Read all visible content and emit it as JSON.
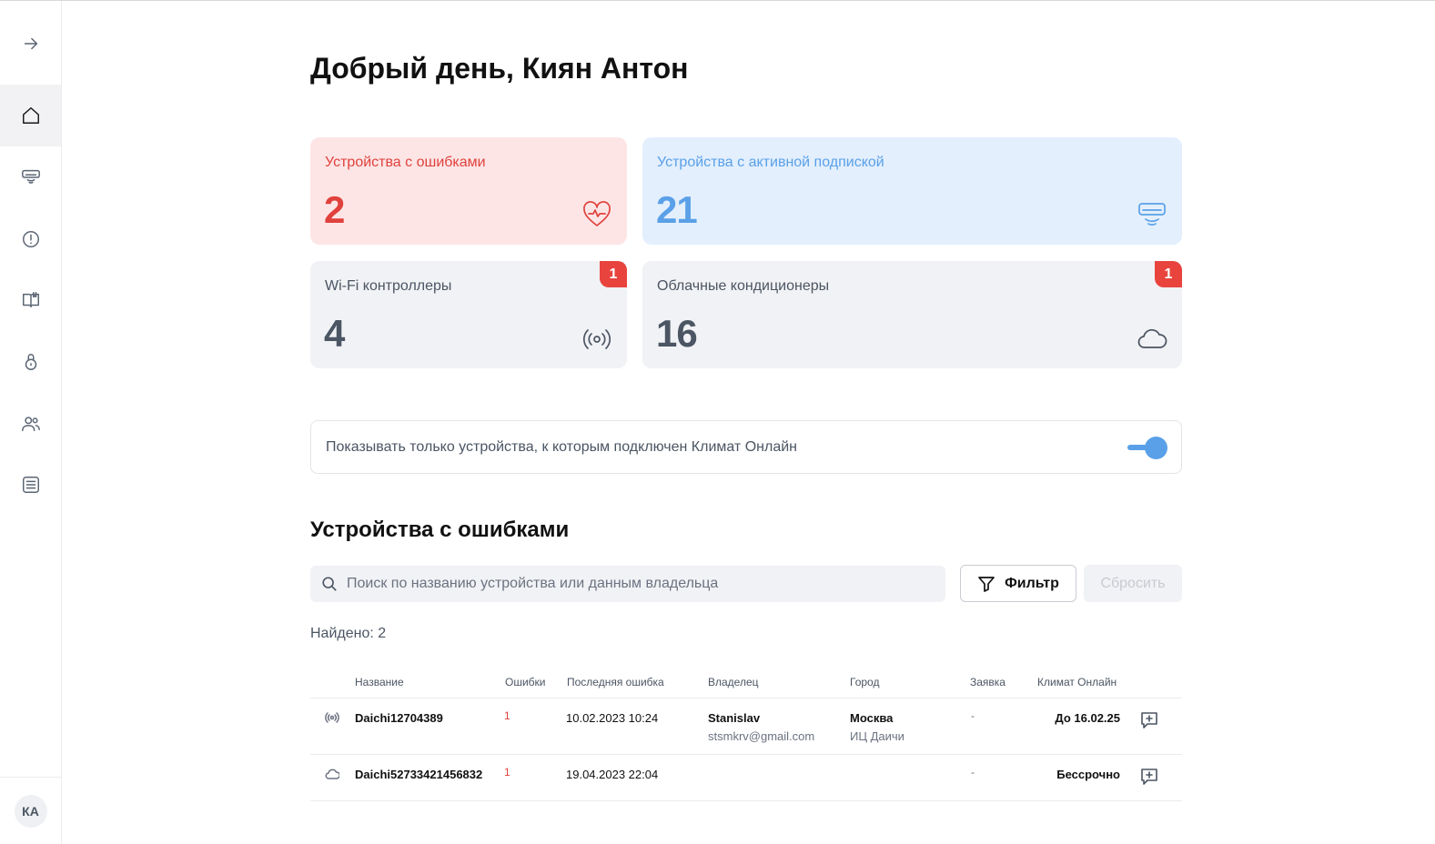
{
  "sidebar": {
    "items": [
      {
        "icon": "arrow-right-icon"
      },
      {
        "icon": "home-icon",
        "active": true
      },
      {
        "icon": "air-conditioner-icon"
      },
      {
        "icon": "alert-circle-icon"
      },
      {
        "icon": "book-icon"
      },
      {
        "icon": "lock-icon"
      },
      {
        "icon": "users-icon"
      },
      {
        "icon": "list-icon"
      }
    ],
    "avatar_initials": "КА"
  },
  "greeting": "Добрый день, Киян Антон",
  "cards": {
    "errors": {
      "title": "Устройства с ошибками",
      "value": "2",
      "icon": "heart-pulse-icon",
      "color": "#e0413c",
      "bg": "#fde5e6"
    },
    "subscription": {
      "title": "Устройства с активной подпиской",
      "value": "21",
      "icon": "air-conditioner-icon",
      "color": "#5aa0e8",
      "bg": "#e3effd"
    },
    "wifi": {
      "title": "Wi-Fi контроллеры",
      "value": "4",
      "badge": "1",
      "icon": "broadcast-icon"
    },
    "cloud": {
      "title": "Облачные кондиционеры",
      "value": "16",
      "badge": "1",
      "icon": "cloud-icon"
    }
  },
  "toggle": {
    "label": "Показывать только устройства, к которым подключен Климат Онлайн",
    "on": true
  },
  "section_title": "Устройства с ошибками",
  "search": {
    "placeholder": "Поиск по названию устройства или данным владельца",
    "value": ""
  },
  "filter_label": "Фильтр",
  "reset_label": "Сбросить",
  "found_text": "Найдено: 2",
  "table": {
    "columns": [
      "Название",
      "Ошибки",
      "Последняя ошибка",
      "Владелец",
      "Город",
      "Заявка",
      "Климат Онлайн"
    ],
    "rows": [
      {
        "type_icon": "broadcast-icon",
        "name": "Daichi12704389",
        "errors": "1",
        "last_error": "10.02.2023 10:24",
        "owner_name": "Stanislav",
        "owner_email": "stsmkrv@gmail.com",
        "city": "Москва",
        "city_sub": "ИЦ Даичи",
        "request": "-",
        "climate_online": "До 16.02.25"
      },
      {
        "type_icon": "cloud-icon",
        "name": "Daichi52733421456832",
        "errors": "1",
        "last_error": "19.04.2023 22:04",
        "owner_name": "",
        "owner_email": "",
        "city": "",
        "city_sub": "",
        "request": "-",
        "climate_online": "Бессрочно"
      }
    ]
  },
  "colors": {
    "accent": "#5aa0e8",
    "error": "#e0413c",
    "badge": "#e8443d"
  }
}
